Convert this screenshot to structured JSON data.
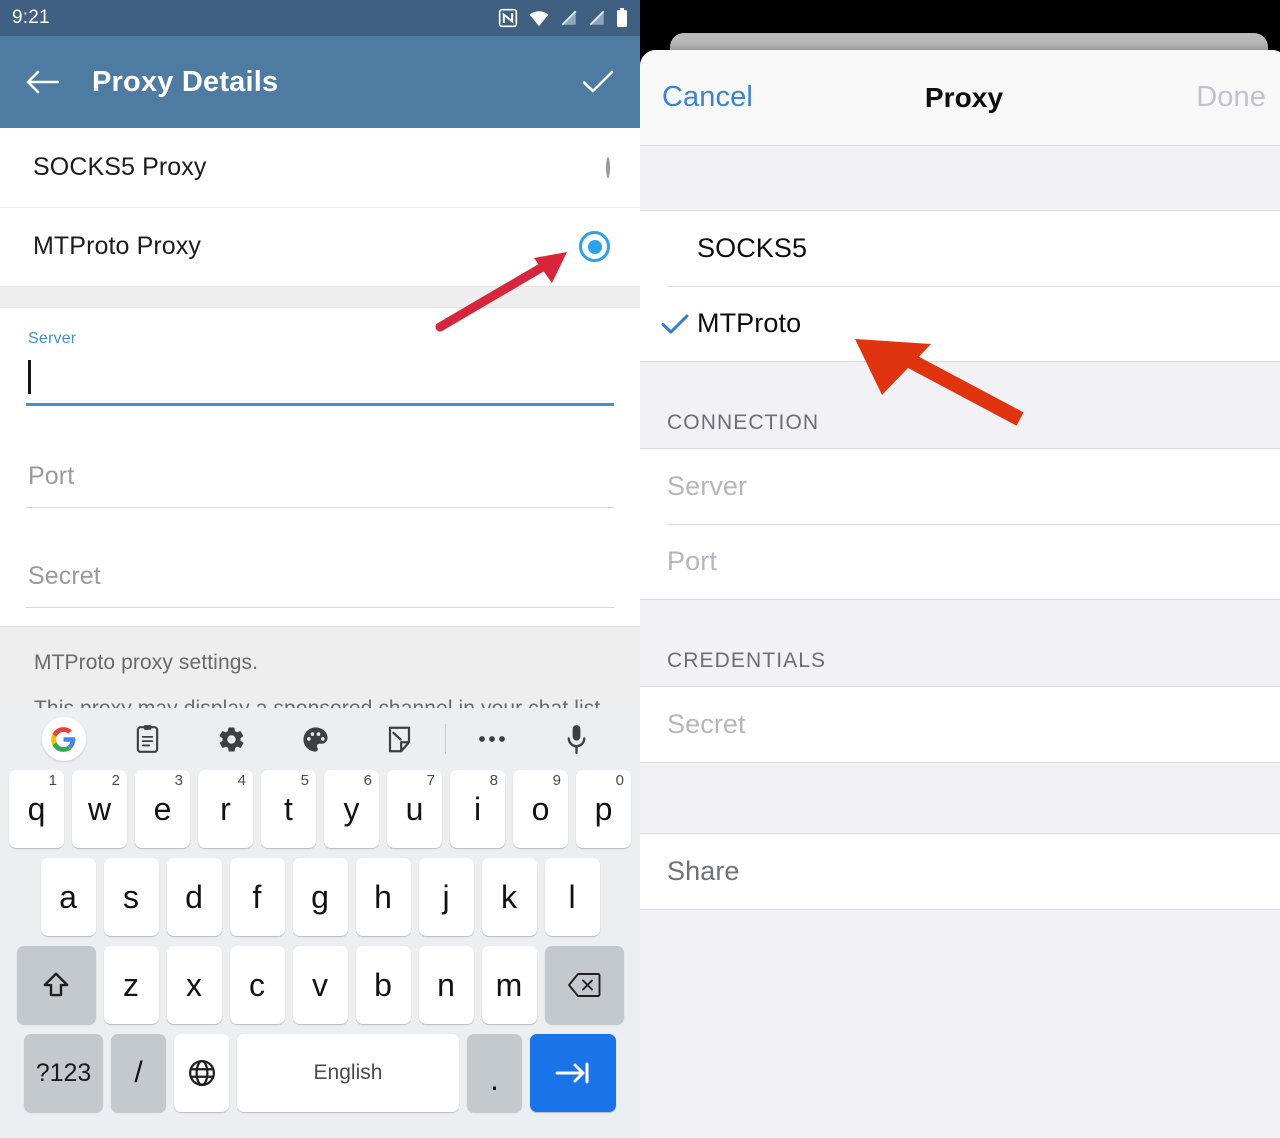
{
  "android": {
    "status_bar": {
      "time": "9:21",
      "icons": [
        "nfc-icon",
        "wifi-icon",
        "signal-off-icon",
        "signal-off-2-icon",
        "battery-icon"
      ]
    },
    "app_bar": {
      "back_icon": "back-arrow-icon",
      "title": "Proxy Details",
      "confirm_icon": "checkmark-icon"
    },
    "proxy_types": [
      {
        "label": "SOCKS5 Proxy",
        "selected": false
      },
      {
        "label": "MTProto Proxy",
        "selected": true
      }
    ],
    "fields": {
      "server": {
        "label": "Server",
        "value": "",
        "focused": true
      },
      "port": {
        "placeholder": "Port",
        "value": ""
      },
      "secret": {
        "placeholder": "Secret",
        "value": ""
      }
    },
    "footer_note": {
      "line1": "MTProto proxy settings.",
      "line2": "This proxy may display a sponsored channel in your chat list. This doesn't reveal any of your Telegram traffic."
    },
    "keyboard": {
      "toolbar_icons": [
        "google-logo-icon",
        "clipboard-icon",
        "gear-icon",
        "palette-icon",
        "sticker-icon",
        "more-icon",
        "microphone-icon"
      ],
      "row1": [
        {
          "key": "q",
          "num": "1"
        },
        {
          "key": "w",
          "num": "2"
        },
        {
          "key": "e",
          "num": "3"
        },
        {
          "key": "r",
          "num": "4"
        },
        {
          "key": "t",
          "num": "5"
        },
        {
          "key": "y",
          "num": "6"
        },
        {
          "key": "u",
          "num": "7"
        },
        {
          "key": "i",
          "num": "8"
        },
        {
          "key": "o",
          "num": "9"
        },
        {
          "key": "p",
          "num": "0"
        }
      ],
      "row2": [
        {
          "key": "a"
        },
        {
          "key": "s"
        },
        {
          "key": "d"
        },
        {
          "key": "f"
        },
        {
          "key": "g"
        },
        {
          "key": "h"
        },
        {
          "key": "j"
        },
        {
          "key": "k"
        },
        {
          "key": "l"
        }
      ],
      "row3_letters": [
        {
          "key": "z"
        },
        {
          "key": "x"
        },
        {
          "key": "c"
        },
        {
          "key": "v"
        },
        {
          "key": "b"
        },
        {
          "key": "n"
        },
        {
          "key": "m"
        }
      ],
      "shift_icon": "shift-icon",
      "backspace_icon": "backspace-icon",
      "symbols_label": "?123",
      "slash_label": "/",
      "globe_icon": "globe-icon",
      "space_label": "English",
      "period_label": ".",
      "enter_icon": "next-field-icon"
    }
  },
  "ios": {
    "nav": {
      "cancel_label": "Cancel",
      "title": "Proxy",
      "done_label": "Done"
    },
    "type_options": [
      {
        "label": "SOCKS5",
        "checked": false
      },
      {
        "label": "MTProto",
        "checked": true
      }
    ],
    "sections": [
      {
        "header": "CONNECTION",
        "rows": [
          {
            "label": "Server",
            "style": "placeholder"
          },
          {
            "label": "Port",
            "style": "placeholder"
          }
        ]
      },
      {
        "header": "CREDENTIALS",
        "rows": [
          {
            "label": "Secret",
            "style": "placeholder"
          }
        ]
      }
    ],
    "share_row": {
      "label": "Share"
    },
    "check_icon": "checkmark-icon"
  },
  "annotations": {
    "left_arrow": {
      "name": "red-arrow-pointing-to-mtproto-radio",
      "color": "#d8253c"
    },
    "right_arrow": {
      "name": "red-arrow-pointing-to-mtproto-row",
      "color": "#e0330f"
    }
  },
  "colors": {
    "android_status_bar": "#3f6081",
    "android_app_bar": "#4e7ba2",
    "android_accent": "#2aa3e8",
    "android_field_active": "#3e92cf",
    "ios_tint": "#3b82d4",
    "ios_group_bg": "#f1f1f6",
    "keyboard_bg": "#eceff1",
    "enter_key": "#1a73e8"
  }
}
